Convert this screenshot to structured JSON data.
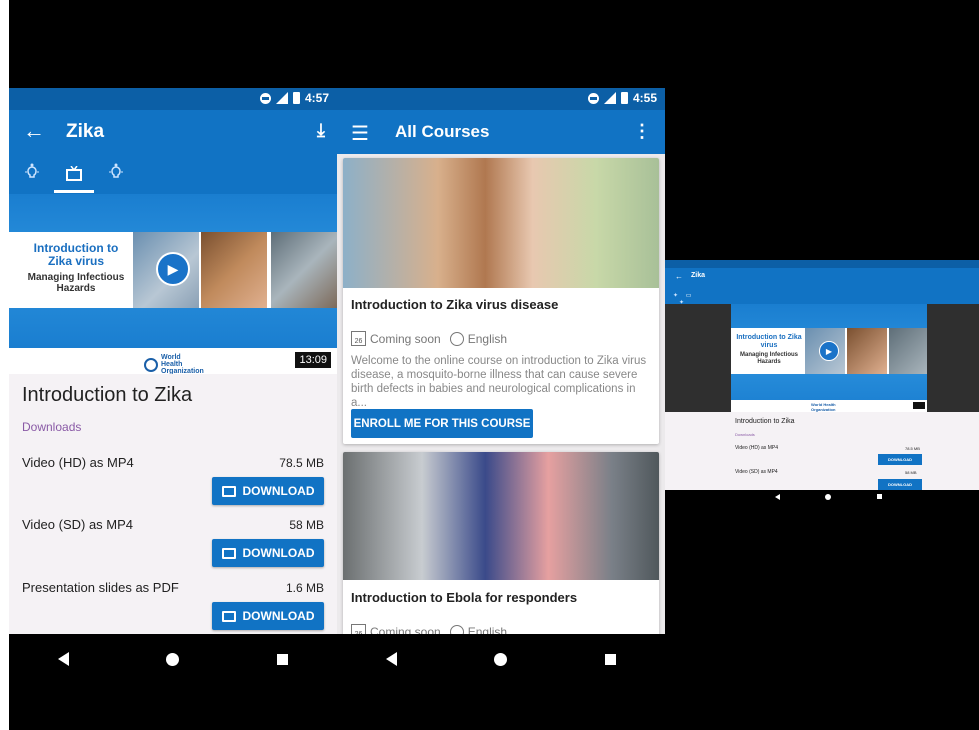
{
  "colors": {
    "primary": "#1173c4",
    "status_bar": "#0c5fa6",
    "downloads_label": "#8a5aa6",
    "content_bg": "#f5f2f5"
  },
  "screen1": {
    "status": {
      "time": "4:57"
    },
    "appbar": {
      "back_icon": "arrow-back-icon",
      "title": "Zika",
      "download_icon": "download-icon"
    },
    "tabs": [
      {
        "icon": "lightbulb-icon"
      },
      {
        "icon": "tv-icon",
        "active": true
      },
      {
        "icon": "lightbulb-icon"
      }
    ],
    "video": {
      "title": "Introduction to Zika virus",
      "subtitle": "Managing Infectious Hazards",
      "org": "World Health Organization",
      "duration": "13:09"
    },
    "content": {
      "title": "Introduction to Zika",
      "downloads_label": "Downloads",
      "items": [
        {
          "label": "Video (HD) as MP4",
          "size": "78.5 MB",
          "button": "DOWNLOAD"
        },
        {
          "label": "Video (SD) as MP4",
          "size": "58 MB",
          "button": "DOWNLOAD"
        },
        {
          "label": "Presentation slides as PDF",
          "size": "1.6 MB",
          "button": "DOWNLOAD"
        }
      ]
    }
  },
  "screen2": {
    "status": {
      "time": "4:55"
    },
    "appbar": {
      "menu_icon": "menu-icon",
      "title": "All Courses",
      "more_icon": "more-vert-icon"
    },
    "courses": [
      {
        "title": "Introduction to Zika virus disease",
        "date_icon_text": "26",
        "availability": "Coming soon",
        "language": "English",
        "description": "Welcome to the online course on introduction to Zika virus disease, a mosquito-borne illness that can cause severe birth defects in babies and neurological complications in a...",
        "button": "ENROLL ME FOR THIS COURSE"
      },
      {
        "title": "Introduction to Ebola for responders",
        "date_icon_text": "26",
        "availability": "Coming soon",
        "language": "English"
      }
    ]
  },
  "screen3": {
    "appbar": {
      "title": "Zika"
    },
    "video": {
      "title": "Introduction to Zika virus",
      "subtitle": "Managing Infectious Hazards",
      "org": "World Health Organization"
    },
    "content": {
      "title": "Introduction to Zika",
      "downloads_label": "Downloads",
      "items": [
        {
          "label": "Video (HD) as MP4",
          "size": "78.5 MB",
          "button": "DOWNLOAD"
        },
        {
          "label": "Video (SD) as MP4",
          "size": "58 MB",
          "button": "DOWNLOAD"
        }
      ]
    }
  }
}
